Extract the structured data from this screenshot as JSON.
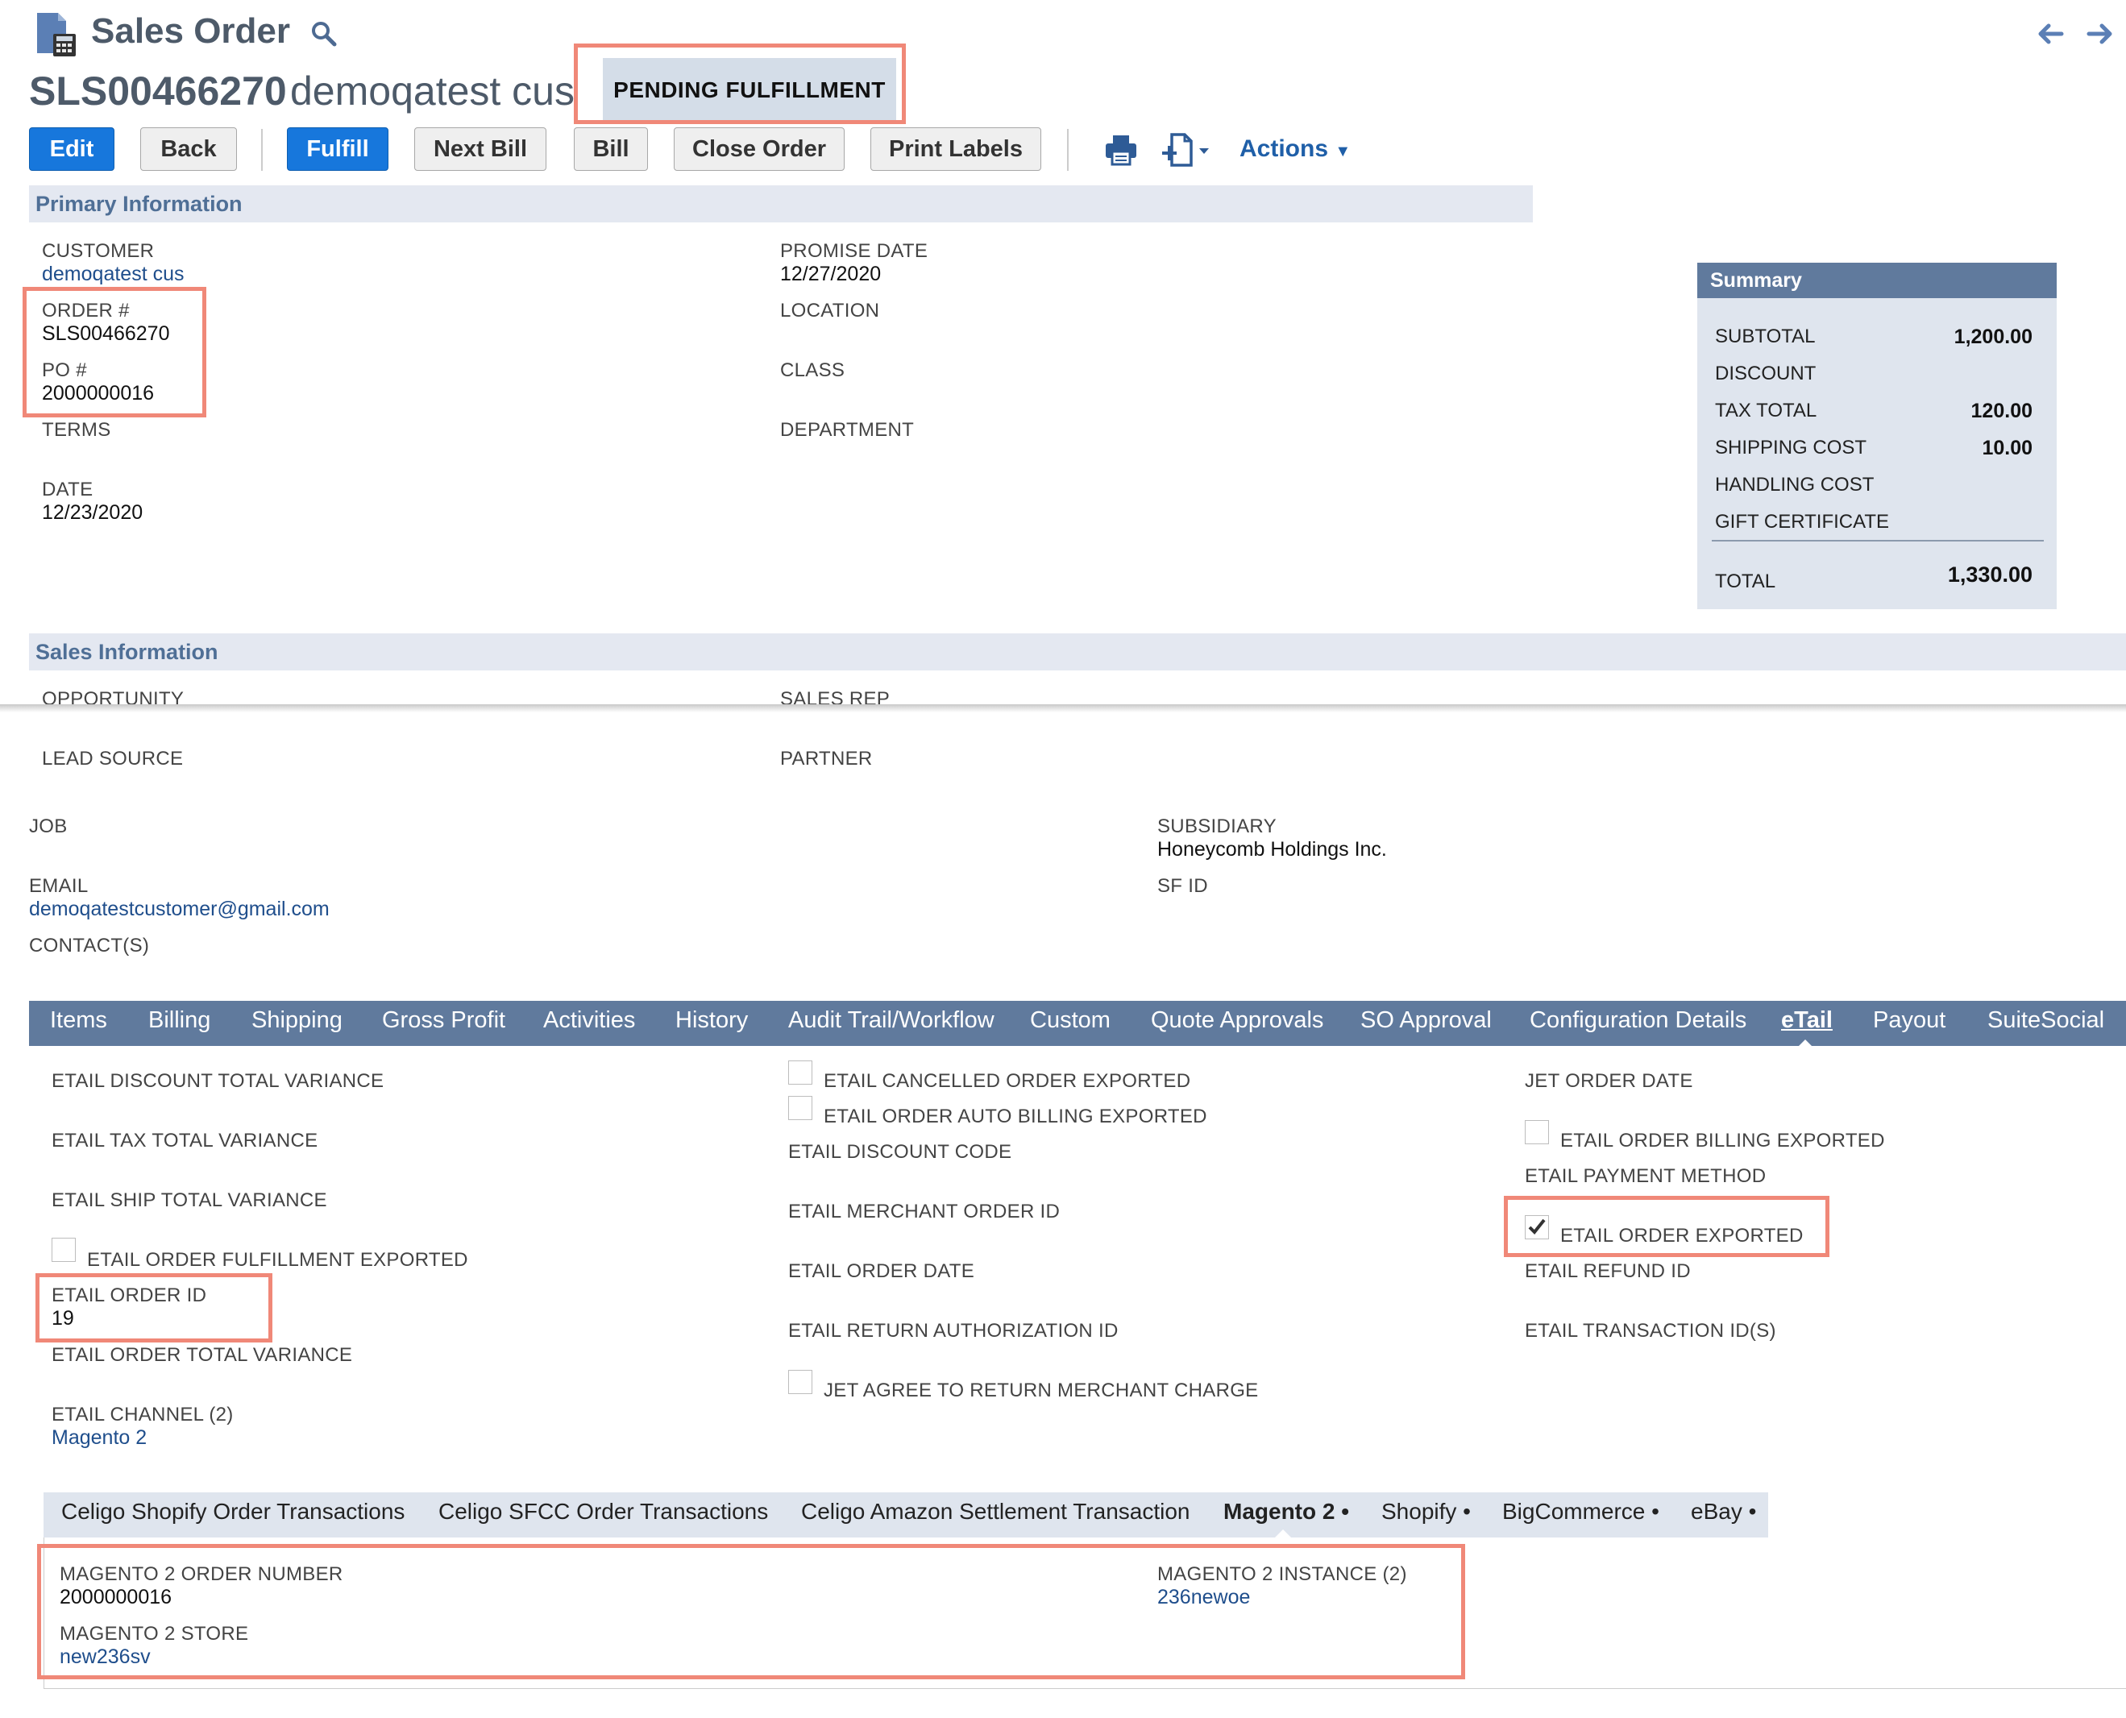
{
  "header": {
    "title": "Sales Order",
    "record_number": "SLS00466270",
    "record_name": "demoqatest cus",
    "status": "PENDING FULFILLMENT"
  },
  "toolbar": {
    "edit": "Edit",
    "back": "Back",
    "fulfill": "Fulfill",
    "next_bill": "Next Bill",
    "bill": "Bill",
    "close_order": "Close Order",
    "print_labels": "Print Labels",
    "actions": "Actions"
  },
  "primary": {
    "section": "Primary Information",
    "customer_label": "CUSTOMER",
    "customer": "demoqatest cus",
    "order_label": "ORDER #",
    "order": "SLS00466270",
    "po_label": "PO #",
    "po": "2000000016",
    "terms_label": "TERMS",
    "date_label": "DATE",
    "date": "12/23/2020",
    "promise_label": "PROMISE DATE",
    "promise": "12/27/2020",
    "location_label": "LOCATION",
    "class_label": "CLASS",
    "department_label": "DEPARTMENT"
  },
  "summary": {
    "title": "Summary",
    "subtotal_label": "SUBTOTAL",
    "subtotal": "1,200.00",
    "discount_label": "DISCOUNT",
    "tax_label": "TAX TOTAL",
    "tax": "120.00",
    "shipping_label": "SHIPPING COST",
    "shipping": "10.00",
    "handling_label": "HANDLING COST",
    "gift_label": "GIFT CERTIFICATE",
    "total_label": "TOTAL",
    "total": "1,330.00"
  },
  "sales": {
    "section": "Sales Information",
    "opportunity_label": "OPPORTUNITY",
    "salesrep_label": "SALES REP",
    "leadsource_label": "LEAD SOURCE",
    "partner_label": "PARTNER",
    "job_label": "JOB",
    "subsidiary_label": "SUBSIDIARY",
    "subsidiary": "Honeycomb Holdings Inc.",
    "email_label": "EMAIL",
    "email": "demoqatestcustomer@gmail.com",
    "sfid_label": "SF ID",
    "contacts_label": "CONTACT(S)"
  },
  "tabs": [
    "Items",
    "Billing",
    "Shipping",
    "Gross Profit",
    "Activities",
    "History",
    "Audit Trail/Workflow",
    "Custom",
    "Quote Approvals",
    "SO Approval",
    "Configuration Details",
    "eTail",
    "Payout",
    "SuiteSocial"
  ],
  "etail": {
    "discount_variance": "ETAIL DISCOUNT TOTAL VARIANCE",
    "tax_variance": "ETAIL TAX TOTAL VARIANCE",
    "ship_variance": "ETAIL SHIP TOTAL VARIANCE",
    "fulfillment_exported": "ETAIL ORDER FULFILLMENT EXPORTED",
    "order_id_label": "ETAIL ORDER ID",
    "order_id": "19",
    "total_variance": "ETAIL ORDER TOTAL VARIANCE",
    "channel_label": "ETAIL CHANNEL (2)",
    "channel": "Magento 2",
    "cancelled_exported": "ETAIL CANCELLED ORDER EXPORTED",
    "auto_billing_exported": "ETAIL ORDER AUTO BILLING EXPORTED",
    "discount_code": "ETAIL DISCOUNT CODE",
    "merchant_order_id": "ETAIL MERCHANT ORDER ID",
    "order_date": "ETAIL ORDER DATE",
    "return_auth_id": "ETAIL RETURN AUTHORIZATION ID",
    "jet_agree": "JET AGREE TO RETURN MERCHANT CHARGE",
    "jet_order_date": "JET ORDER DATE",
    "billing_exported": "ETAIL ORDER BILLING EXPORTED",
    "payment_method": "ETAIL PAYMENT METHOD",
    "order_exported": "ETAIL ORDER EXPORTED",
    "refund_id": "ETAIL REFUND ID",
    "transaction_ids": "ETAIL TRANSACTION ID(S)"
  },
  "subtabs": [
    "Celigo Shopify Order Transactions",
    "Celigo SFCC Order Transactions",
    "Celigo Amazon Settlement Transaction",
    "Magento 2",
    "Shopify",
    "BigCommerce",
    "eBay"
  ],
  "magento": {
    "order_number_label": "MAGENTO 2 ORDER NUMBER",
    "order_number": "2000000016",
    "store_label": "MAGENTO 2 STORE",
    "store": "new236sv",
    "instance_label": "MAGENTO 2 INSTANCE (2)",
    "instance": "236newoe"
  }
}
